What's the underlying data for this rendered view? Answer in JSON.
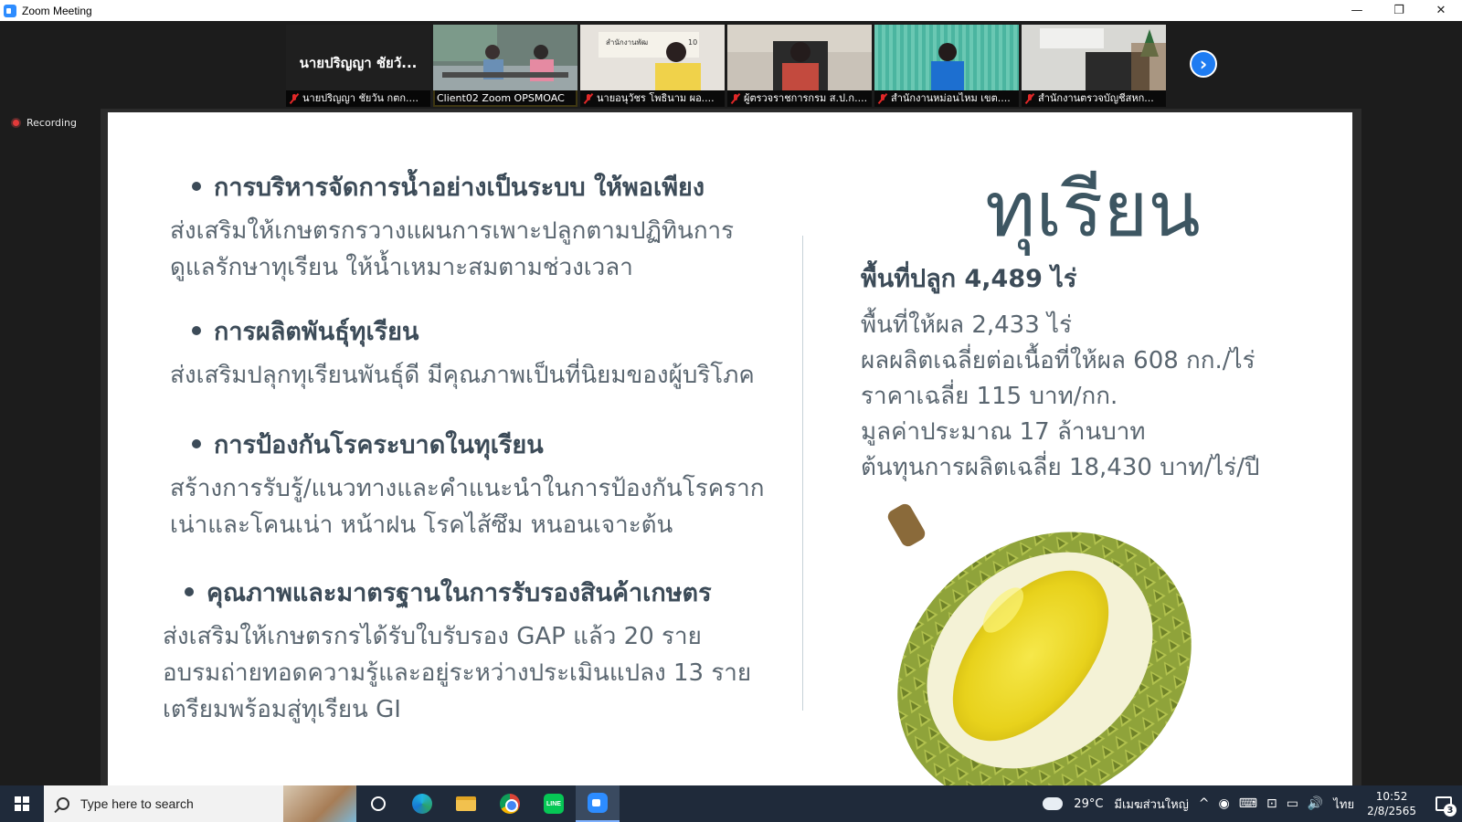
{
  "window": {
    "title": "Zoom Meeting",
    "minimize_icon": "—",
    "restore_icon": "❐",
    "close_icon": "✕"
  },
  "meeting": {
    "recording_label": "Recording",
    "participants": [
      {
        "display_name": "นายปริญญา ชัยวั...",
        "caption": "นายปริญญา ชัยวัน กตก....",
        "muted": true,
        "video": false
      },
      {
        "caption": "Client02 Zoom OPSMOAC",
        "muted": false,
        "video": true,
        "active": true
      },
      {
        "caption": "นายอนุวัชร โพธินาม ผอ....",
        "muted": true,
        "video": true
      },
      {
        "caption": "ผู้ตรวจราชการกรม ส.ป.ก....",
        "muted": true,
        "video": true
      },
      {
        "caption": "สำนักงานหม่อนไหม เขต....",
        "muted": true,
        "video": true
      },
      {
        "caption": "สำนักงานตรวจบัญชีสหก...",
        "muted": true,
        "video": true
      }
    ],
    "thumb_sign_text": "สำนักงานพัฒ",
    "thumb_sign_num": "10",
    "next_icon": "›"
  },
  "slide": {
    "sections": [
      {
        "heading": "การบริหารจัดการน้ำอย่างเป็นระบบ ให้พอเพียง",
        "lines": [
          "ส่งเสริมให้เกษตรกรวางแผนการเพาะปลูกตามปฏิทินการ",
          "ดูแลรักษาทุเรียน ให้น้ำเหมาะสมตามช่วงเวลา"
        ]
      },
      {
        "heading": "การผลิตพันธุ์ทุเรียน",
        "lines": [
          "ส่งเสริมปลุกทุเรียนพันธุ์ดี มีคุณภาพเป็นที่นิยมของผู้บริโภค"
        ]
      },
      {
        "heading": "การป้องกันโรคระบาดในทุเรียน",
        "lines": [
          "สร้างการรับรู้/แนวทางและคำแนะนำในการป้องกันโรคราก",
          "เน่าและโคนเน่า หน้าฝน โรคไส้ซึม หนอนเจาะต้น"
        ]
      },
      {
        "heading": "คุณภาพและมาตรฐานในการรับรองสินค้าเกษตร",
        "lines": [
          "ส่งเสริมให้เกษตรกรได้รับใบรับรอง GAP แล้ว 20 ราย",
          "อบรมถ่ายทอดความรู้และอยู่ระหว่างประเมินแปลง 13 ราย",
          "เตรียมพร้อมสู่ทุเรียน GI"
        ]
      }
    ],
    "title": "ทุเรียน",
    "planting_area": "พื้นที่ปลูก 4,489 ไร่",
    "stats": [
      "พื้นที่ให้ผล 2,433 ไร่",
      "ผลผลิตเฉลี่ยต่อเนื้อที่ให้ผล 608 กก./ไร่",
      "ราคาเฉลี่ย 115 บาท/กก.",
      "มูลค่าประมาณ 17 ล้านบาท",
      "ต้นทุนการผลิตเฉลี่ย 18,430 บาท/ไร่/ปี"
    ]
  },
  "taskbar": {
    "search_placeholder": "Type here to search",
    "line_label": "LINE",
    "weather_temp": "29°C",
    "weather_desc": "มีเมฆส่วนใหญ่",
    "tray_glyphs": [
      "^",
      "◉",
      "⌨",
      "⊡",
      "▭",
      "🔊"
    ],
    "language": "ไทย",
    "time": "10:52",
    "date": "2/8/2565",
    "notification_count": "3"
  }
}
